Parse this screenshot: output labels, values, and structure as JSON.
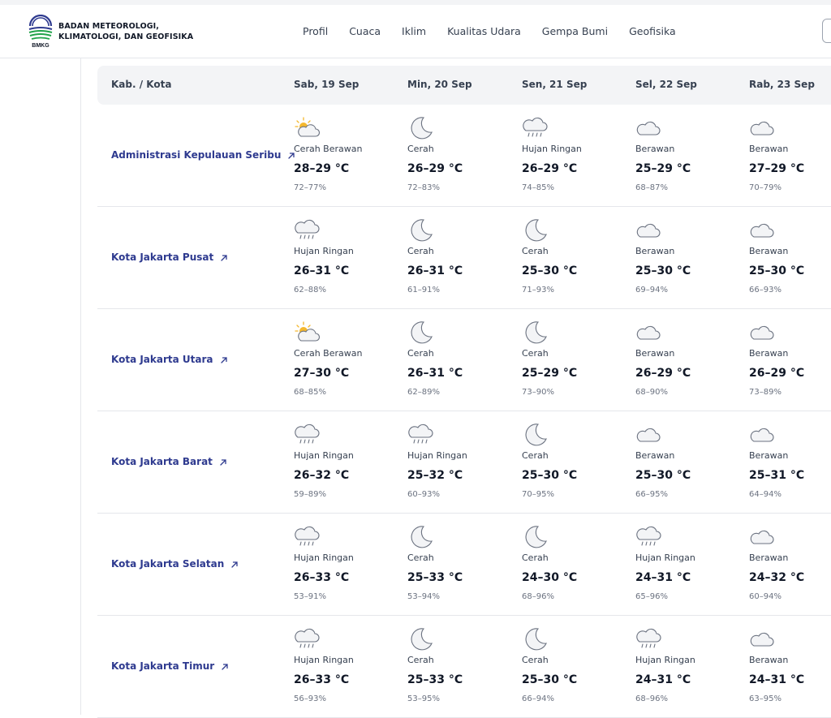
{
  "header": {
    "org_line1": "BADAN METEOROLOGI,",
    "org_line2": "KLIMATOLOGI, DAN GEOFISIKA",
    "logo_text": "BMKG",
    "nav": [
      "Profil",
      "Cuaca",
      "Iklim",
      "Kualitas Udara",
      "Gempa Bumi",
      "Geofisika"
    ]
  },
  "table": {
    "region_header": "Kab. / Kota",
    "days": [
      "Sab, 19 Sep",
      "Min, 20 Sep",
      "Sen, 21 Sep",
      "Sel, 22 Sep",
      "Rab, 23 Sep"
    ],
    "rows": [
      {
        "region": "Administrasi Kepulauan Seribu",
        "cells": [
          {
            "icon": "partly-sunny-icon",
            "cond": "Cerah Berawan",
            "temp": "28–29 °C",
            "hum": "72–77%"
          },
          {
            "icon": "moon-icon",
            "cond": "Cerah",
            "temp": "26–29 °C",
            "hum": "72–83%"
          },
          {
            "icon": "rain-cloud-icon",
            "cond": "Hujan Ringan",
            "temp": "26–29 °C",
            "hum": "74–85%"
          },
          {
            "icon": "cloud-icon",
            "cond": "Berawan",
            "temp": "25–29 °C",
            "hum": "68–87%"
          },
          {
            "icon": "cloud-icon",
            "cond": "Berawan",
            "temp": "27–29 °C",
            "hum": "70–79%"
          }
        ]
      },
      {
        "region": "Kota Jakarta Pusat",
        "cells": [
          {
            "icon": "rain-cloud-icon",
            "cond": "Hujan Ringan",
            "temp": "26–31 °C",
            "hum": "62–88%"
          },
          {
            "icon": "moon-icon",
            "cond": "Cerah",
            "temp": "26–31 °C",
            "hum": "61–91%"
          },
          {
            "icon": "moon-icon",
            "cond": "Cerah",
            "temp": "25–30 °C",
            "hum": "71–93%"
          },
          {
            "icon": "cloud-icon",
            "cond": "Berawan",
            "temp": "25–30 °C",
            "hum": "69–94%"
          },
          {
            "icon": "cloud-icon",
            "cond": "Berawan",
            "temp": "25–30 °C",
            "hum": "66–93%"
          }
        ]
      },
      {
        "region": "Kota Jakarta Utara",
        "cells": [
          {
            "icon": "partly-sunny-icon",
            "cond": "Cerah Berawan",
            "temp": "27–30 °C",
            "hum": "68–85%"
          },
          {
            "icon": "moon-icon",
            "cond": "Cerah",
            "temp": "26–31 °C",
            "hum": "62–89%"
          },
          {
            "icon": "moon-icon",
            "cond": "Cerah",
            "temp": "25–29 °C",
            "hum": "73–90%"
          },
          {
            "icon": "cloud-icon",
            "cond": "Berawan",
            "temp": "26–29 °C",
            "hum": "68–90%"
          },
          {
            "icon": "cloud-icon",
            "cond": "Berawan",
            "temp": "26–29 °C",
            "hum": "73–89%"
          }
        ]
      },
      {
        "region": "Kota Jakarta Barat",
        "cells": [
          {
            "icon": "rain-cloud-icon",
            "cond": "Hujan Ringan",
            "temp": "26–32 °C",
            "hum": "59–89%"
          },
          {
            "icon": "rain-cloud-icon",
            "cond": "Hujan Ringan",
            "temp": "25–32 °C",
            "hum": "60–93%"
          },
          {
            "icon": "moon-icon",
            "cond": "Cerah",
            "temp": "25–30 °C",
            "hum": "70–95%"
          },
          {
            "icon": "cloud-icon",
            "cond": "Berawan",
            "temp": "25–30 °C",
            "hum": "66–95%"
          },
          {
            "icon": "cloud-icon",
            "cond": "Berawan",
            "temp": "25–31 °C",
            "hum": "64–94%"
          }
        ]
      },
      {
        "region": "Kota Jakarta Selatan",
        "cells": [
          {
            "icon": "rain-cloud-icon",
            "cond": "Hujan Ringan",
            "temp": "26–33 °C",
            "hum": "53–91%"
          },
          {
            "icon": "moon-icon",
            "cond": "Cerah",
            "temp": "25–33 °C",
            "hum": "53–94%"
          },
          {
            "icon": "moon-icon",
            "cond": "Cerah",
            "temp": "24–30 °C",
            "hum": "68–96%"
          },
          {
            "icon": "rain-cloud-icon",
            "cond": "Hujan Ringan",
            "temp": "24–31 °C",
            "hum": "65–96%"
          },
          {
            "icon": "cloud-icon",
            "cond": "Berawan",
            "temp": "24–32 °C",
            "hum": "60–94%"
          }
        ]
      },
      {
        "region": "Kota Jakarta Timur",
        "cells": [
          {
            "icon": "rain-cloud-icon",
            "cond": "Hujan Ringan",
            "temp": "26–33 °C",
            "hum": "56–93%"
          },
          {
            "icon": "moon-icon",
            "cond": "Cerah",
            "temp": "25–33 °C",
            "hum": "53–95%"
          },
          {
            "icon": "moon-icon",
            "cond": "Cerah",
            "temp": "25–30 °C",
            "hum": "66–94%"
          },
          {
            "icon": "rain-cloud-icon",
            "cond": "Hujan Ringan",
            "temp": "24–31 °C",
            "hum": "68–96%"
          },
          {
            "icon": "cloud-icon",
            "cond": "Berawan",
            "temp": "24–31 °C",
            "hum": "63–95%"
          }
        ]
      }
    ]
  },
  "colors": {
    "link": "#2e3a8f",
    "header_bg": "#f3f4f6",
    "sun": "#f5b82e",
    "cloud_stroke": "#6b7280"
  }
}
